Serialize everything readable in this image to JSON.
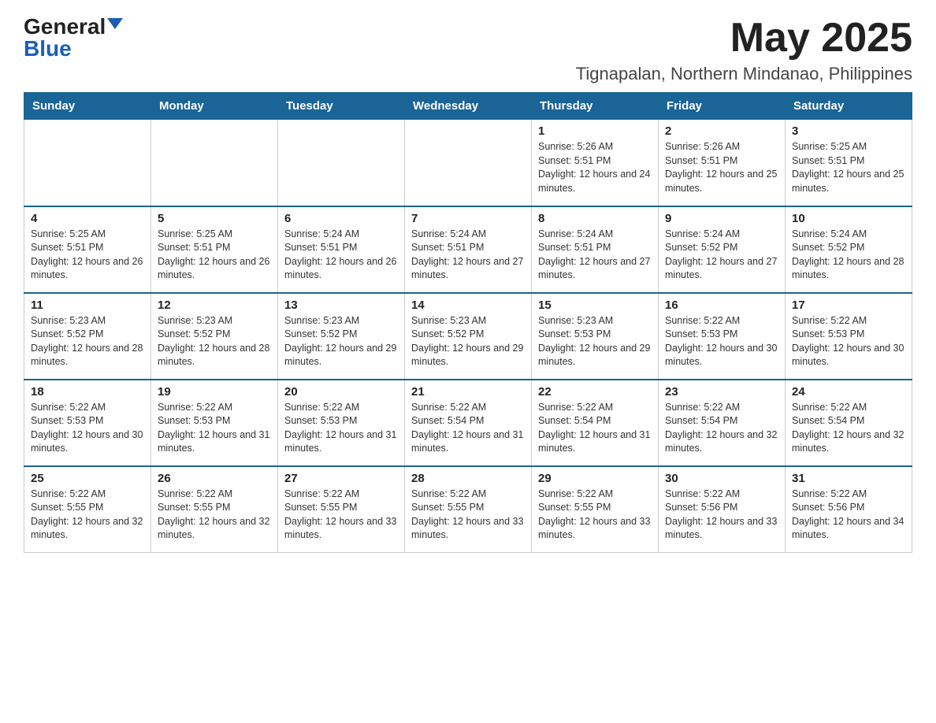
{
  "logo": {
    "general": "General",
    "blue": "Blue"
  },
  "title": "May 2025",
  "location": "Tignapalan, Northern Mindanao, Philippines",
  "days_of_week": [
    "Sunday",
    "Monday",
    "Tuesday",
    "Wednesday",
    "Thursday",
    "Friday",
    "Saturday"
  ],
  "weeks": [
    [
      {
        "day": "",
        "info": ""
      },
      {
        "day": "",
        "info": ""
      },
      {
        "day": "",
        "info": ""
      },
      {
        "day": "",
        "info": ""
      },
      {
        "day": "1",
        "info": "Sunrise: 5:26 AM\nSunset: 5:51 PM\nDaylight: 12 hours and 24 minutes."
      },
      {
        "day": "2",
        "info": "Sunrise: 5:26 AM\nSunset: 5:51 PM\nDaylight: 12 hours and 25 minutes."
      },
      {
        "day": "3",
        "info": "Sunrise: 5:25 AM\nSunset: 5:51 PM\nDaylight: 12 hours and 25 minutes."
      }
    ],
    [
      {
        "day": "4",
        "info": "Sunrise: 5:25 AM\nSunset: 5:51 PM\nDaylight: 12 hours and 26 minutes."
      },
      {
        "day": "5",
        "info": "Sunrise: 5:25 AM\nSunset: 5:51 PM\nDaylight: 12 hours and 26 minutes."
      },
      {
        "day": "6",
        "info": "Sunrise: 5:24 AM\nSunset: 5:51 PM\nDaylight: 12 hours and 26 minutes."
      },
      {
        "day": "7",
        "info": "Sunrise: 5:24 AM\nSunset: 5:51 PM\nDaylight: 12 hours and 27 minutes."
      },
      {
        "day": "8",
        "info": "Sunrise: 5:24 AM\nSunset: 5:51 PM\nDaylight: 12 hours and 27 minutes."
      },
      {
        "day": "9",
        "info": "Sunrise: 5:24 AM\nSunset: 5:52 PM\nDaylight: 12 hours and 27 minutes."
      },
      {
        "day": "10",
        "info": "Sunrise: 5:24 AM\nSunset: 5:52 PM\nDaylight: 12 hours and 28 minutes."
      }
    ],
    [
      {
        "day": "11",
        "info": "Sunrise: 5:23 AM\nSunset: 5:52 PM\nDaylight: 12 hours and 28 minutes."
      },
      {
        "day": "12",
        "info": "Sunrise: 5:23 AM\nSunset: 5:52 PM\nDaylight: 12 hours and 28 minutes."
      },
      {
        "day": "13",
        "info": "Sunrise: 5:23 AM\nSunset: 5:52 PM\nDaylight: 12 hours and 29 minutes."
      },
      {
        "day": "14",
        "info": "Sunrise: 5:23 AM\nSunset: 5:52 PM\nDaylight: 12 hours and 29 minutes."
      },
      {
        "day": "15",
        "info": "Sunrise: 5:23 AM\nSunset: 5:53 PM\nDaylight: 12 hours and 29 minutes."
      },
      {
        "day": "16",
        "info": "Sunrise: 5:22 AM\nSunset: 5:53 PM\nDaylight: 12 hours and 30 minutes."
      },
      {
        "day": "17",
        "info": "Sunrise: 5:22 AM\nSunset: 5:53 PM\nDaylight: 12 hours and 30 minutes."
      }
    ],
    [
      {
        "day": "18",
        "info": "Sunrise: 5:22 AM\nSunset: 5:53 PM\nDaylight: 12 hours and 30 minutes."
      },
      {
        "day": "19",
        "info": "Sunrise: 5:22 AM\nSunset: 5:53 PM\nDaylight: 12 hours and 31 minutes."
      },
      {
        "day": "20",
        "info": "Sunrise: 5:22 AM\nSunset: 5:53 PM\nDaylight: 12 hours and 31 minutes."
      },
      {
        "day": "21",
        "info": "Sunrise: 5:22 AM\nSunset: 5:54 PM\nDaylight: 12 hours and 31 minutes."
      },
      {
        "day": "22",
        "info": "Sunrise: 5:22 AM\nSunset: 5:54 PM\nDaylight: 12 hours and 31 minutes."
      },
      {
        "day": "23",
        "info": "Sunrise: 5:22 AM\nSunset: 5:54 PM\nDaylight: 12 hours and 32 minutes."
      },
      {
        "day": "24",
        "info": "Sunrise: 5:22 AM\nSunset: 5:54 PM\nDaylight: 12 hours and 32 minutes."
      }
    ],
    [
      {
        "day": "25",
        "info": "Sunrise: 5:22 AM\nSunset: 5:55 PM\nDaylight: 12 hours and 32 minutes."
      },
      {
        "day": "26",
        "info": "Sunrise: 5:22 AM\nSunset: 5:55 PM\nDaylight: 12 hours and 32 minutes."
      },
      {
        "day": "27",
        "info": "Sunrise: 5:22 AM\nSunset: 5:55 PM\nDaylight: 12 hours and 33 minutes."
      },
      {
        "day": "28",
        "info": "Sunrise: 5:22 AM\nSunset: 5:55 PM\nDaylight: 12 hours and 33 minutes."
      },
      {
        "day": "29",
        "info": "Sunrise: 5:22 AM\nSunset: 5:55 PM\nDaylight: 12 hours and 33 minutes."
      },
      {
        "day": "30",
        "info": "Sunrise: 5:22 AM\nSunset: 5:56 PM\nDaylight: 12 hours and 33 minutes."
      },
      {
        "day": "31",
        "info": "Sunrise: 5:22 AM\nSunset: 5:56 PM\nDaylight: 12 hours and 34 minutes."
      }
    ]
  ]
}
